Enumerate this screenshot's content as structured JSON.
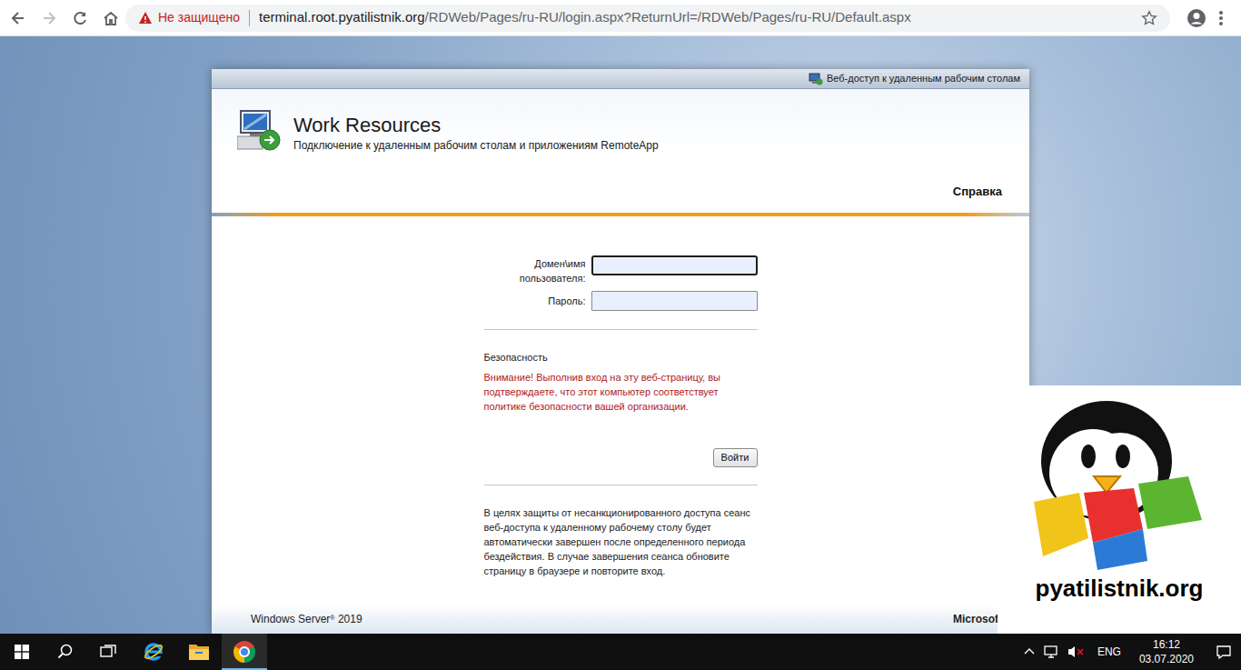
{
  "browser": {
    "security_label": "Не защищено",
    "url_host": "terminal.root.pyatilistnik.org",
    "url_path": "/RDWeb/Pages/ru-RU/login.aspx?ReturnUrl=/RDWeb/Pages/ru-RU/Default.aspx"
  },
  "page": {
    "top_link": "Веб-доступ к удаленным рабочим столам",
    "title": "Work Resources",
    "subtitle": "Подключение к удаленным рабочим столам и приложениям RemoteApp",
    "help": "Справка",
    "form": {
      "fields": [
        {
          "label": "Домен\\имя пользователя:",
          "value": "",
          "focused": true
        },
        {
          "label": "Пароль:",
          "value": "",
          "focused": false
        }
      ],
      "security_heading": "Безопасность",
      "warning": "Внимание! Выполнив вход на эту веб-страницу, вы подтверждаете, что этот компьютер соответствует политике безопасности вашей организации.",
      "button": "Войти",
      "info": "В целях защиты от несанкционированного доступа сеанс веб-доступа к удаленному рабочему столу будет автоматически завершен после определенного периода бездействия. В случае завершения сеанса обновите страницу в браузере и повторите вход."
    },
    "footer": {
      "product": "Windows Server",
      "product_mark": "®",
      "version": "2019",
      "vendor": "Microsoft"
    }
  },
  "watermark": {
    "text": "pyatilistnik.org"
  },
  "taskbar": {
    "apps": [
      {
        "kind": "ie",
        "active": false
      },
      {
        "kind": "explorer",
        "active": false
      },
      {
        "kind": "chrome",
        "active": true
      }
    ],
    "volume_muted": true,
    "language": "ENG",
    "time": "16:12",
    "date": "03.07.2020"
  }
}
